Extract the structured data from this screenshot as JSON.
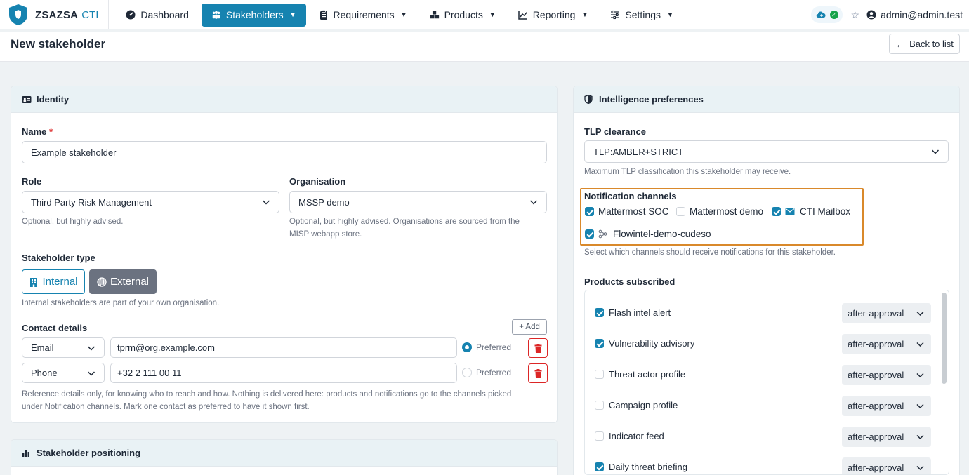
{
  "nav": {
    "brand_name": "ZSAZSA",
    "brand_suffix": "CTI",
    "items": [
      {
        "label": "Dashboard",
        "icon": "gauge-icon"
      },
      {
        "label": "Stakeholders",
        "icon": "users-icon",
        "active": true
      },
      {
        "label": "Requirements",
        "icon": "clipboard-icon"
      },
      {
        "label": "Products",
        "icon": "boxes-icon"
      },
      {
        "label": "Reporting",
        "icon": "chart-line-icon"
      },
      {
        "label": "Settings",
        "icon": "sliders-icon"
      }
    ],
    "user": "admin@admin.test"
  },
  "header": {
    "title": "New stakeholder",
    "back_label": "Back to list"
  },
  "identity": {
    "title": "Identity",
    "name_label": "Name",
    "name_required_mark": "*",
    "name_value": "Example stakeholder",
    "role_label": "Role",
    "role_value": "Third Party Risk Management",
    "role_help": "Optional, but highly advised.",
    "org_label": "Organisation",
    "org_value": "MSSP demo",
    "org_help_1": "Optional, but highly advised. Organisations are sourced from the",
    "org_help_2": "MISP webapp store.",
    "type_label": "Stakeholder type",
    "type_internal": "Internal",
    "type_external": "External",
    "type_help": "Internal stakeholders are part of your own organisation.",
    "contact_label": "Contact details",
    "add_label": "+ Add",
    "contacts": [
      {
        "type": "Email",
        "value": "tprm@org.example.com",
        "preferred_label": "Preferred",
        "preferred": true
      },
      {
        "type": "Phone",
        "value": "+32 2 111 00 11",
        "preferred_label": "Preferred",
        "preferred": false
      }
    ],
    "contact_help_1": "Reference details only, for knowing who to reach and how. Nothing is delivered here: products and notifications go to the channels picked",
    "contact_help_2": "under Notification channels. Mark one contact as preferred to have it shown first."
  },
  "positioning": {
    "title": "Stakeholder positioning"
  },
  "intel": {
    "title": "Intelligence preferences",
    "tlp_label": "TLP clearance",
    "tlp_value": "TLP:AMBER+STRICT",
    "tlp_help": "Maximum TLP classification this stakeholder may receive.",
    "notif_label": "Notification channels",
    "channels": [
      {
        "label": "Mattermost SOC",
        "checked": true
      },
      {
        "label": "Mattermost demo",
        "checked": false
      },
      {
        "label": "CTI Mailbox",
        "checked": true,
        "icon": "envelope-icon"
      },
      {
        "label": "Flowintel-demo-cudeso",
        "checked": true,
        "icon": "flow-icon"
      }
    ],
    "notif_help": "Select which channels should receive notifications for this stakeholder.",
    "products_label": "Products subscribed",
    "products": [
      {
        "name": "Flash intel alert",
        "checked": true,
        "mode": "after-approval"
      },
      {
        "name": "Vulnerability advisory",
        "checked": true,
        "mode": "after-approval"
      },
      {
        "name": "Threat actor profile",
        "checked": false,
        "mode": "after-approval"
      },
      {
        "name": "Campaign profile",
        "checked": false,
        "mode": "after-approval"
      },
      {
        "name": "Indicator feed",
        "checked": false,
        "mode": "after-approval"
      },
      {
        "name": "Daily threat briefing",
        "checked": true,
        "mode": "after-approval"
      }
    ]
  },
  "colors": {
    "accent": "#1683b0",
    "highlight_box": "#d9892b",
    "danger": "#dc2626"
  }
}
